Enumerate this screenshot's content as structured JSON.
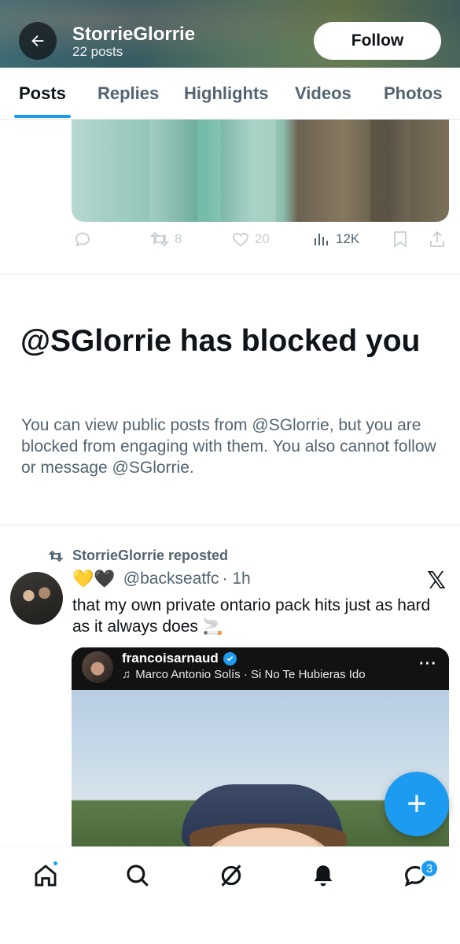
{
  "header": {
    "name": "StorrieGlorrie",
    "post_count": "22 posts",
    "follow_label": "Follow"
  },
  "tabs": [
    {
      "label": "Posts",
      "active": true
    },
    {
      "label": "Replies",
      "active": false
    },
    {
      "label": "Highlights",
      "active": false
    },
    {
      "label": "Videos",
      "active": false
    },
    {
      "label": "Photos",
      "active": false
    }
  ],
  "previous_post": {
    "reposts": "8",
    "likes": "20",
    "views": "12K"
  },
  "blocked_notice": {
    "title": "@SGlorrie has blocked you",
    "body": "You can view public posts from @SGlorrie, but you are blocked from engaging with them. You also cannot follow or message @SGlorrie."
  },
  "repost": {
    "repost_label": "StorrieGlorrie reposted",
    "emojis": "💛🖤",
    "handle": "@backseatfc",
    "time": "· 1h",
    "source_icon": "x-logo-icon",
    "text": "that my own private ontario pack hits just as hard as it always does 🚬",
    "embed": {
      "username": "francoisarnaud",
      "song": "Marco Antonio Solís · Si No Te Hubieras Ido",
      "more": "···"
    }
  },
  "fab_label": "+",
  "bottom_nav": {
    "items": [
      "home-icon",
      "search-icon",
      "grok-icon",
      "notifications-icon",
      "messages-icon"
    ],
    "messages_badge": "3"
  },
  "colors": {
    "accent": "#1d9bf0",
    "text_primary": "#0f1419",
    "text_secondary": "#536471"
  }
}
